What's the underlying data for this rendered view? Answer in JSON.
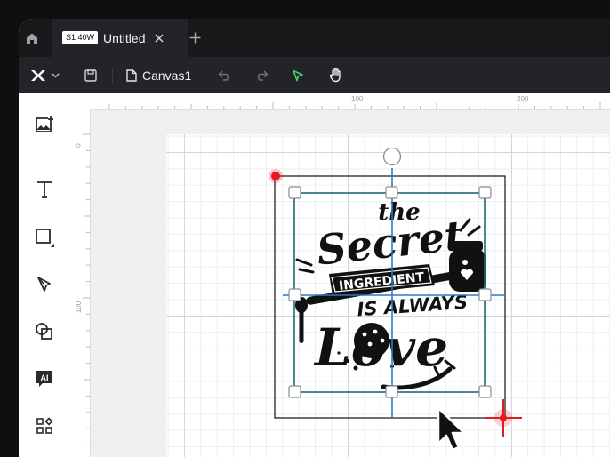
{
  "tab": {
    "badge": "S1 40W",
    "title": "Untitled"
  },
  "toolbar": {
    "canvas_name": "Canvas1"
  },
  "ruler": {
    "top_labels": [
      "100",
      "200"
    ],
    "left_labels": [
      "0",
      "100",
      "200"
    ]
  },
  "design": {
    "line1": "the",
    "line2": "Secret",
    "line3": "INGREDIENT",
    "line4": "IS ALWAYS",
    "line5": "Love"
  },
  "colors": {
    "accent_green": "#3bd16f",
    "selection_blue": "#2f79c8",
    "selection_teal": "#1e6b75",
    "cut_marker_red": "#e11b22"
  },
  "icons": {
    "home": "home-icon",
    "close": "close-icon",
    "add": "plus-icon",
    "logo": "x-logo-icon",
    "save": "save-icon",
    "document": "document-icon",
    "undo": "undo-icon",
    "redo": "redo-icon",
    "run": "play-triangle-icon",
    "hand": "hand-icon"
  }
}
